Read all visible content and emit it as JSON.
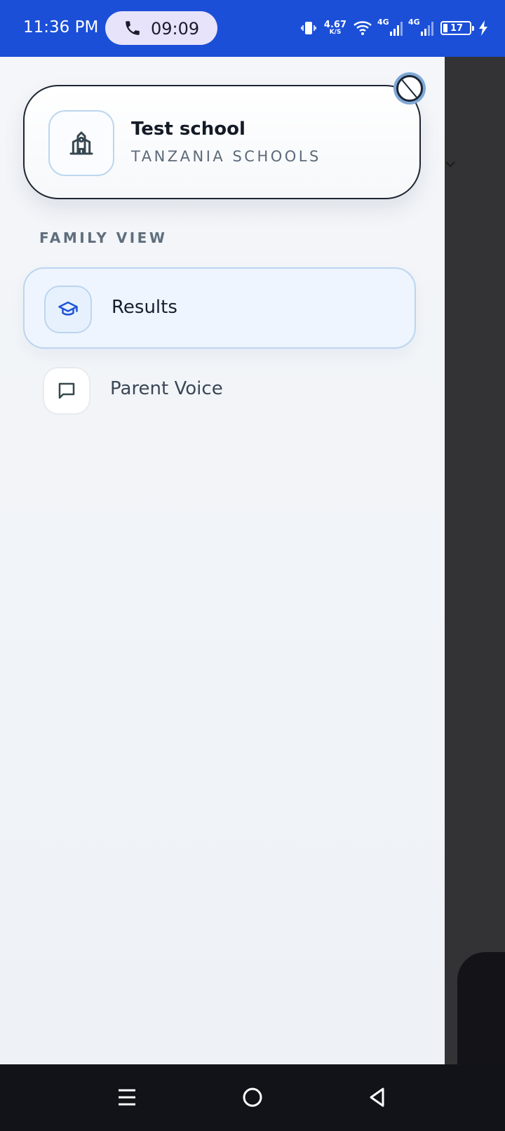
{
  "status_bar": {
    "time": "11:36 PM",
    "call_timer": "09:09",
    "net_speed_value": "4.67",
    "net_speed_unit": "K/S",
    "signal_1_label": "4G",
    "signal_2_label": "4G",
    "battery_level": "17",
    "icons": [
      "phone-icon",
      "vibrate-icon",
      "wifi-icon",
      "signal-icon",
      "signal-icon",
      "battery-icon",
      "charging-icon"
    ]
  },
  "drawer": {
    "school": {
      "name": "Test school",
      "organization": "TANZANIA SCHOOLS",
      "icon": "school-building-icon"
    },
    "section_label": "FAMILY VIEW",
    "items": [
      {
        "label": "Results",
        "icon": "graduation-cap-icon",
        "active": true
      },
      {
        "label": "Parent Voice",
        "icon": "message-square-icon",
        "active": false
      }
    ]
  },
  "colors": {
    "status_bar_bg": "#1b4fd8",
    "accent": "#1f56d6",
    "drawer_bg": "#f4f6f9",
    "active_item_bg": "#eef5ff",
    "nav_bar_bg": "#121219"
  },
  "system_nav": {
    "buttons": [
      "recent-apps-icon",
      "home-icon",
      "back-icon"
    ]
  }
}
